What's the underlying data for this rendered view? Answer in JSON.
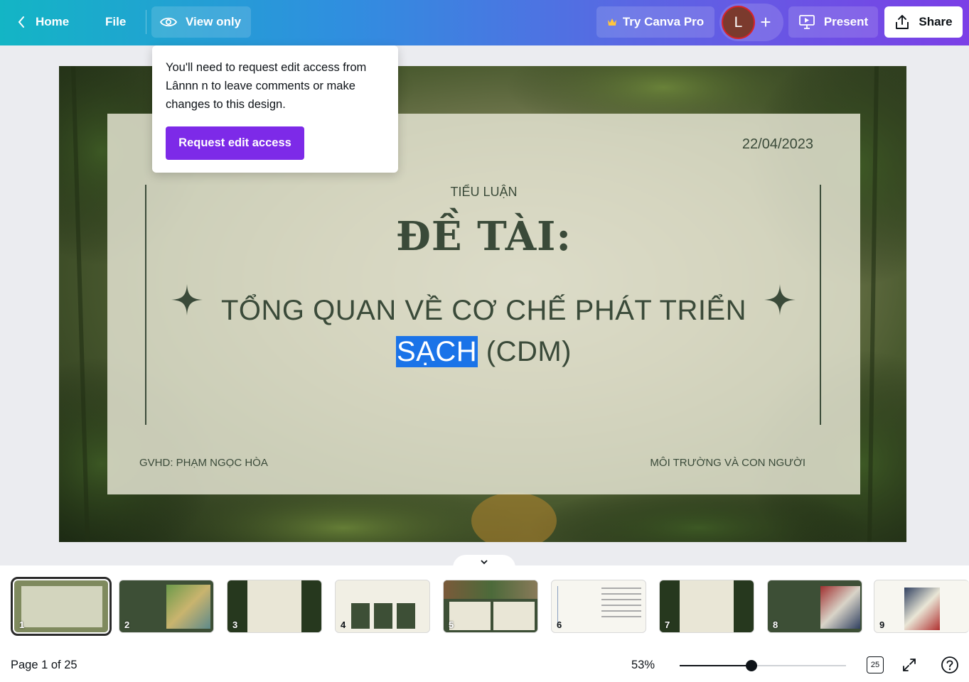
{
  "topbar": {
    "home_label": "Home",
    "file_label": "File",
    "view_only_label": "View only",
    "try_pro_label": "Try Canva Pro",
    "avatar_initial": "L",
    "present_label": "Present",
    "share_label": "Share"
  },
  "tooltip": {
    "message": "You'll need to request edit access from Lânnn n to leave comments or make changes to this design.",
    "button_label": "Request edit access"
  },
  "slide": {
    "date": "22/04/2023",
    "kicker": "TIỂU LUẬN",
    "title": "ĐỀ TÀI:",
    "subtitle_line1": "TỔNG QUAN VỀ CƠ CHẾ PHÁT TRIỂN",
    "subtitle_selected": "SẠCH",
    "subtitle_rest": " (CDM)",
    "footer_left": "GVHD: PHẠM NGỌC HÒA",
    "footer_right": "MÔI TRƯỜNG VÀ CON NGƯỜI"
  },
  "thumbnails": [
    {
      "num": "1"
    },
    {
      "num": "2"
    },
    {
      "num": "3"
    },
    {
      "num": "4"
    },
    {
      "num": "5"
    },
    {
      "num": "6"
    },
    {
      "num": "7"
    },
    {
      "num": "8"
    },
    {
      "num": "9"
    }
  ],
  "footer": {
    "page_indicator": "Page 1 of 25",
    "zoom": "53%",
    "zoom_level": 0.43,
    "grid_count": "25"
  },
  "colors": {
    "accent_purple": "#7d2ae8",
    "selection_blue": "#1a73e8",
    "slide_text": "#3a4a39"
  }
}
